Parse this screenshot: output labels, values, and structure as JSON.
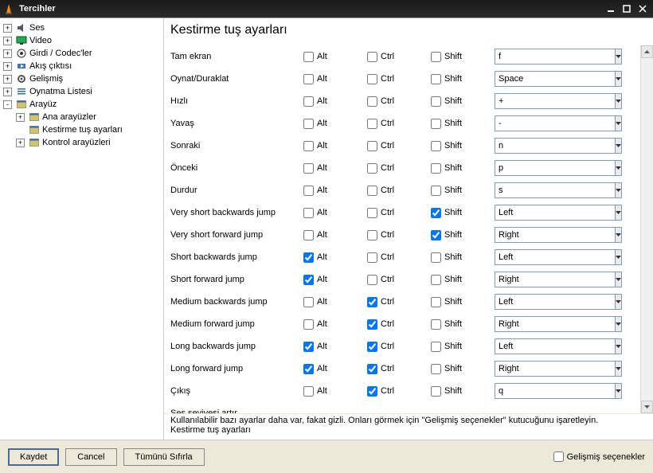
{
  "window": {
    "title": "Tercihler"
  },
  "tree": {
    "items": [
      {
        "level": 0,
        "exp": "+",
        "icon": "speaker",
        "label": "Ses"
      },
      {
        "level": 0,
        "exp": "+",
        "icon": "monitor",
        "label": "Video"
      },
      {
        "level": 0,
        "exp": "+",
        "icon": "codec",
        "label": "Girdi / Codec'ler"
      },
      {
        "level": 0,
        "exp": "+",
        "icon": "stream",
        "label": "Akış çıktısı"
      },
      {
        "level": 0,
        "exp": "+",
        "icon": "gear",
        "label": "Gelişmiş"
      },
      {
        "level": 0,
        "exp": "+",
        "icon": "playlist",
        "label": "Oynatma Listesi"
      },
      {
        "level": 0,
        "exp": "-",
        "icon": "interface",
        "label": "Arayüz"
      },
      {
        "level": 1,
        "exp": "+",
        "icon": "interface",
        "label": "Ana arayüzler"
      },
      {
        "level": 1,
        "exp": "",
        "icon": "interface",
        "label": "Kestirme tuş ayarları",
        "selected": true
      },
      {
        "level": 1,
        "exp": "+",
        "icon": "interface",
        "label": "Kontrol arayüzleri"
      }
    ]
  },
  "panel": {
    "title": "Kestirme tuş ayarları"
  },
  "modifiers": {
    "alt": "Alt",
    "ctrl": "Ctrl",
    "shift": "Shift"
  },
  "hotkeys": [
    {
      "name": "Tam ekran",
      "alt": false,
      "ctrl": false,
      "shift": false,
      "key": "f"
    },
    {
      "name": "Oynat/Duraklat",
      "alt": false,
      "ctrl": false,
      "shift": false,
      "key": "Space"
    },
    {
      "name": "Hızlı",
      "alt": false,
      "ctrl": false,
      "shift": false,
      "key": "+"
    },
    {
      "name": "Yavaş",
      "alt": false,
      "ctrl": false,
      "shift": false,
      "key": "-"
    },
    {
      "name": "Sonraki",
      "alt": false,
      "ctrl": false,
      "shift": false,
      "key": "n"
    },
    {
      "name": "Önceki",
      "alt": false,
      "ctrl": false,
      "shift": false,
      "key": "p"
    },
    {
      "name": "Durdur",
      "alt": false,
      "ctrl": false,
      "shift": false,
      "key": "s"
    },
    {
      "name": "Very short backwards jump",
      "alt": false,
      "ctrl": false,
      "shift": true,
      "key": "Left"
    },
    {
      "name": "Very short forward jump",
      "alt": false,
      "ctrl": false,
      "shift": true,
      "key": "Right"
    },
    {
      "name": "Short backwards jump",
      "alt": true,
      "ctrl": false,
      "shift": false,
      "key": "Left"
    },
    {
      "name": "Short forward jump",
      "alt": true,
      "ctrl": false,
      "shift": false,
      "key": "Right"
    },
    {
      "name": "Medium backwards jump",
      "alt": false,
      "ctrl": true,
      "shift": false,
      "key": "Left"
    },
    {
      "name": "Medium forward jump",
      "alt": false,
      "ctrl": true,
      "shift": false,
      "key": "Right"
    },
    {
      "name": "Long backwards jump",
      "alt": true,
      "ctrl": true,
      "shift": false,
      "key": "Left"
    },
    {
      "name": "Long forward jump",
      "alt": true,
      "ctrl": true,
      "shift": false,
      "key": "Right"
    },
    {
      "name": "Çıkış",
      "alt": false,
      "ctrl": true,
      "shift": false,
      "key": "q"
    },
    {
      "name": "Ses seviyesi artır",
      "alt": false,
      "ctrl": false,
      "shift": false,
      "key": "",
      "partial": true
    }
  ],
  "info": {
    "hint": "Kullanılabilir bazı ayarlar daha var, fakat gizli. Onları görmek için \"Gelişmiş seçenekler\" kutucuğunu işaretleyin.",
    "status": "Kestirme tuş ayarları"
  },
  "footer": {
    "save": "Kaydet",
    "cancel": "Cancel",
    "reset": "Tümünü Sıfırla",
    "advanced": "Gelişmiş seçenekler"
  }
}
